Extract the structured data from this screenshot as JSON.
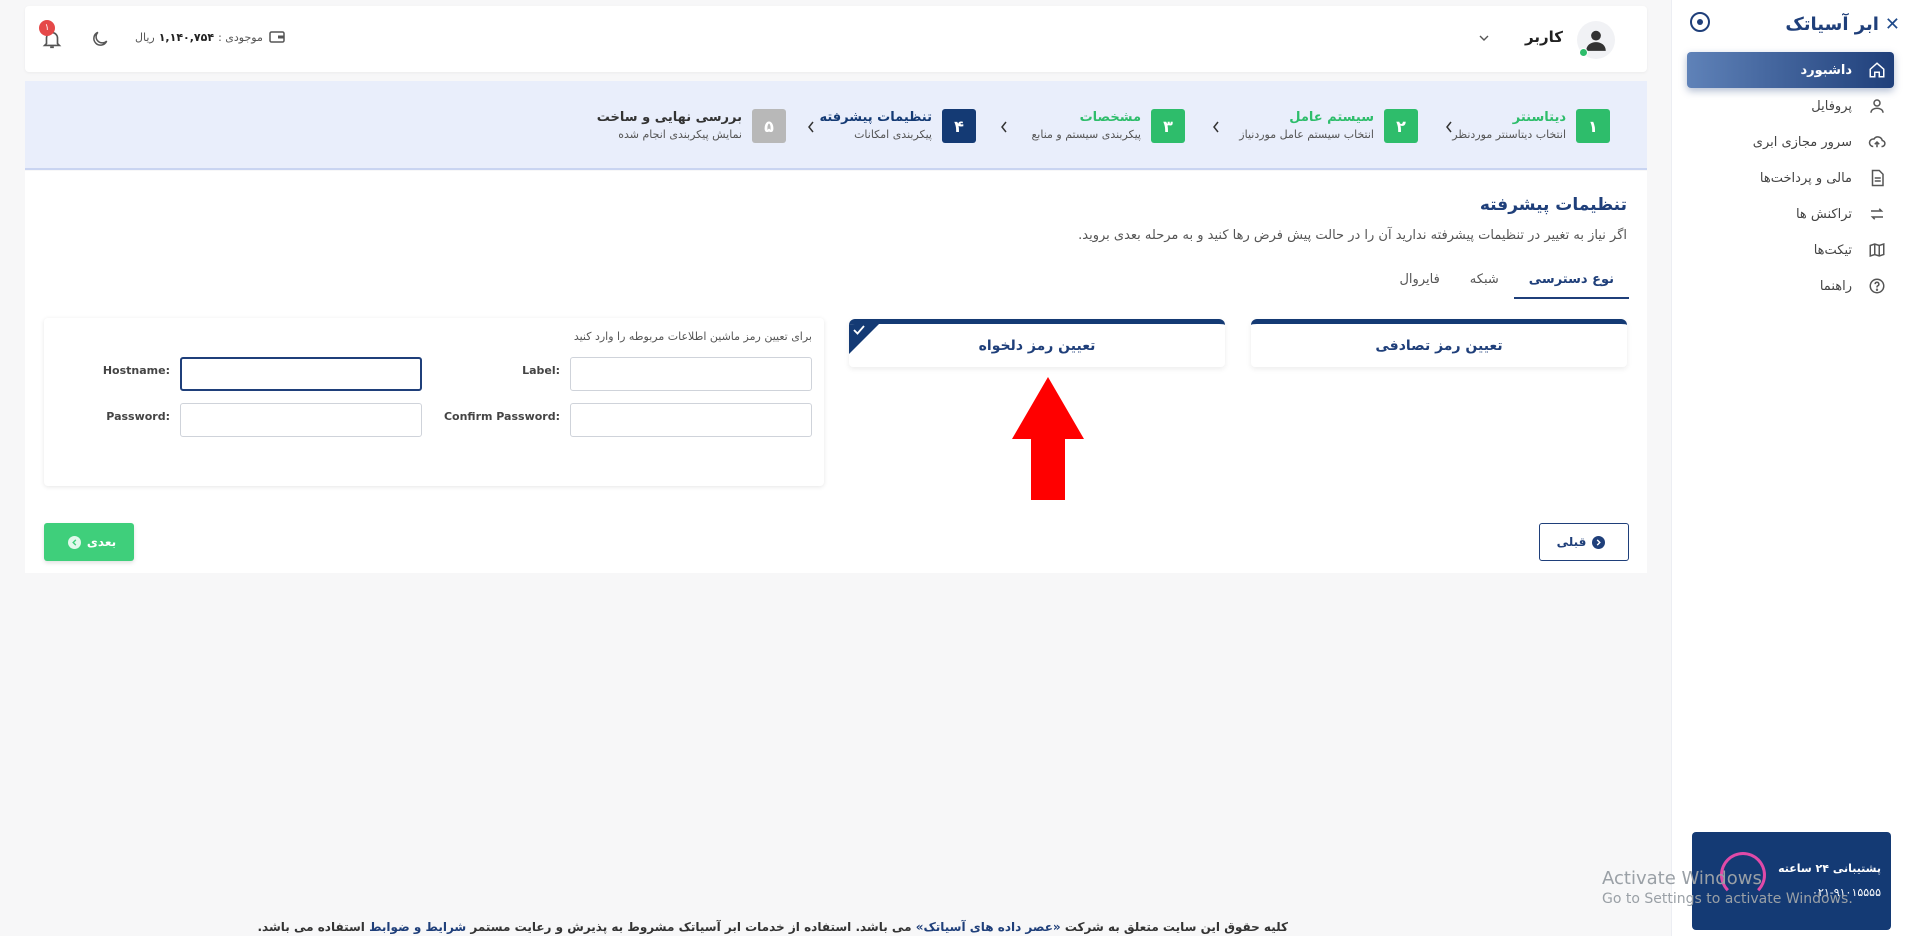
{
  "app": {
    "brand": "ابر آسیاتک",
    "colors": {
      "primary": "#143a74",
      "success": "#2ebd6b",
      "danger": "#e54848",
      "pending": "#b8b8b8"
    }
  },
  "sidebar": {
    "items": [
      {
        "label": "داشبورد",
        "icon": "home-icon",
        "active": true
      },
      {
        "label": "پروفایل",
        "icon": "user-icon",
        "active": false
      },
      {
        "label": "سرور مجازی ابری",
        "icon": "cloud-upload-icon",
        "active": false
      },
      {
        "label": "مالی و پرداخت‌ها",
        "icon": "document-icon",
        "active": false
      },
      {
        "label": "تراکنش ها",
        "icon": "swap-icon",
        "active": false
      },
      {
        "label": "تیکت‌ها",
        "icon": "map-icon",
        "active": false
      },
      {
        "label": "راهنما",
        "icon": "help-icon",
        "active": false
      }
    ],
    "support": {
      "title": "پشتیبانی ۲۴ ساعته",
      "phone": "۰۲۱-۹۱۰۱۵۵۵۵"
    }
  },
  "header": {
    "user_name": "کاربر",
    "wallet_label": "موجودی :",
    "wallet_value": "۱,۱۴۰,۷۵۴",
    "wallet_unit": "ریال",
    "notification_count": "۱"
  },
  "stepper": {
    "steps": [
      {
        "num": "۱",
        "title": "دیتاسنتر",
        "subtitle": "انتخاب دیتاسنتر موردنظر",
        "state": "done"
      },
      {
        "num": "۲",
        "title": "سیستم عامل",
        "subtitle": "انتخاب سیستم عامل موردنیاز",
        "state": "done"
      },
      {
        "num": "۳",
        "title": "مشخصات",
        "subtitle": "پیکربندی سیستم و منابع",
        "state": "done"
      },
      {
        "num": "۴",
        "title": "تنظیمات پیشرفته",
        "subtitle": "پیکربندی امکانات",
        "state": "current"
      },
      {
        "num": "۵",
        "title": "بررسی نهایی و ساخت",
        "subtitle": "نمایش پیکربندی انجام شده",
        "state": "pending"
      }
    ]
  },
  "main": {
    "title": "تنظیمات پیشرفته",
    "description": "اگر نیاز به تغییر در تنظیمات پیشرفته ندارید آن را در حالت پیش فرض رها کنید و به مرحله بعدی بروید.",
    "tabs": [
      {
        "label": "نوع دسترسی",
        "active": true
      },
      {
        "label": "شبکه",
        "active": false
      },
      {
        "label": "فایروال",
        "active": false
      }
    ],
    "options": [
      {
        "label": "تعیین رمز تصادفی",
        "selected": false
      },
      {
        "label": "تعیین رمز دلخواه",
        "selected": true
      }
    ],
    "form": {
      "hint": "برای تعیین رمز ماشین اطلاعات مربوطه را وارد کنید",
      "label_label": "Label:",
      "label_value": "",
      "hostname_label": "Hostname:",
      "hostname_value": "",
      "confirm_label": "Confirm Password:",
      "confirm_value": "",
      "password_label": "Password:",
      "password_value": ""
    },
    "next_label": "بعدی",
    "prev_label": "قبلی"
  },
  "footer": {
    "part1": "کلیه حقوق این سایت متعلق به شرکت ",
    "company": "«عصر داده های آسیاتک»",
    "part2": " می باشد. استفاده از خدمات ابر آسیاتک مشروط به پذیرش و رعایت مستمر ",
    "terms": "شرایط و ضوابط",
    "part3": " استفاده می باشد."
  },
  "os_watermark": {
    "line1": "Activate Windows",
    "line2": "Go to Settings to activate Windows."
  }
}
